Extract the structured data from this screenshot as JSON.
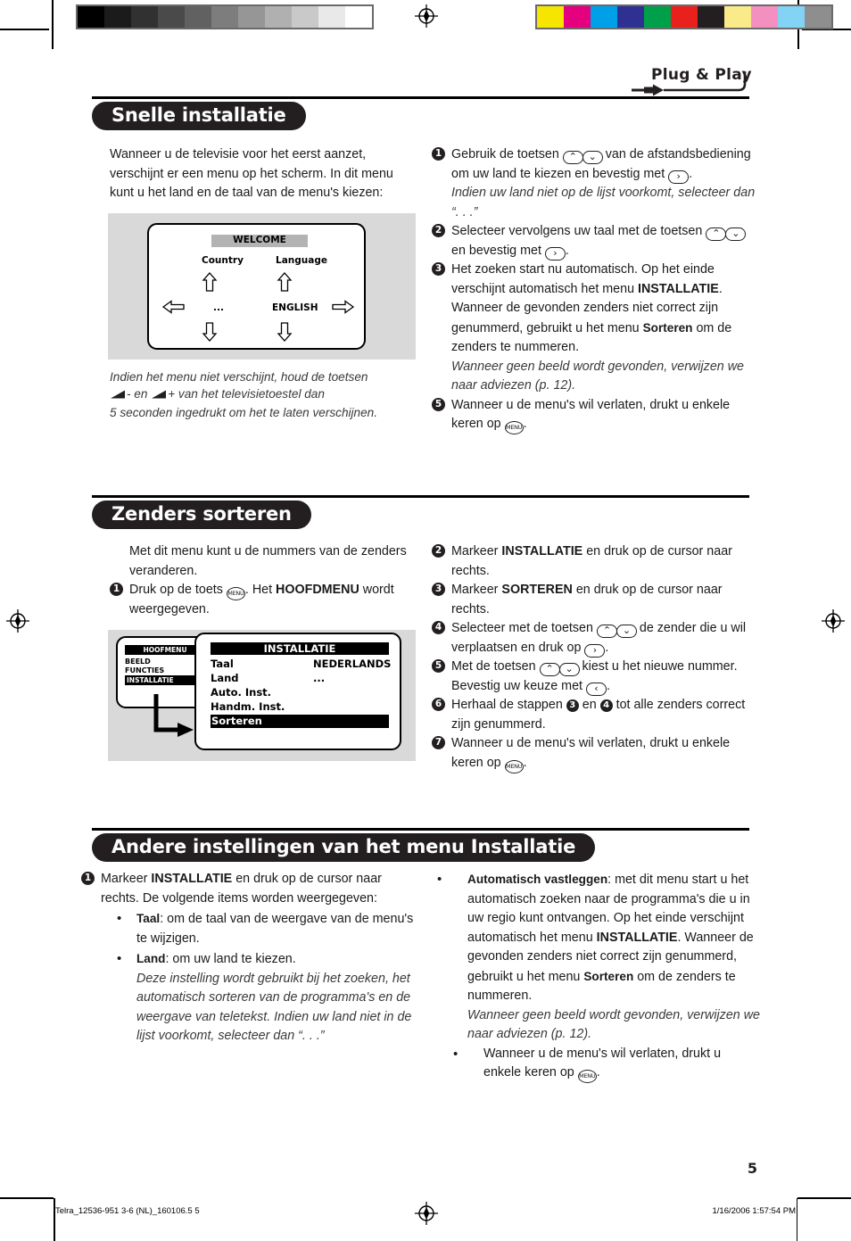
{
  "prepress": {
    "gray_swatches": [
      "#000000",
      "#1b1b1b",
      "#313131",
      "#4a4a4a",
      "#616161",
      "#7d7d7d",
      "#969696",
      "#b0b0b0",
      "#c9c9c9",
      "#e9e9e9",
      "#ffffff"
    ],
    "color_swatches": [
      "#f5e500",
      "#e4007f",
      "#00a0e9",
      "#2e3192",
      "#00a04a",
      "#e8211c",
      "#231f20",
      "#faeb8a",
      "#f490c0",
      "#83d3f5",
      "#8e8e8e"
    ],
    "registration_icon": "registration-target-icon"
  },
  "logo": {
    "text": "Plug & Play",
    "icon": "power-plug-icon"
  },
  "sections": [
    {
      "id": "snelle-installatie",
      "title": "Snelle installatie",
      "intro": "Wanneer u de televisie voor het eerst aanzet, verschijnt er een menu op het scherm. In dit menu kunt u het land en de taal van de menu's kiezen:",
      "figure_note_line1": "Indien het menu niet verschijnt, houd de toetsen",
      "figure_note_line2_a": "- en",
      "figure_note_line2_b": "+ van het televisietoestel dan",
      "figure_note_line3": "5 seconden ingedrukt om het te laten verschijnen.",
      "figure": {
        "name": "welcome-screen",
        "header": "WELCOME",
        "left_label": "Country",
        "left_value": "...",
        "right_label": "Language",
        "right_value": "ENGLISH"
      },
      "steps": [
        {
          "num": "❶",
          "parts": [
            {
              "t": "text",
              "v": "Gebruik de toetsen "
            },
            {
              "t": "keypair",
              "v": "⌃⌄"
            },
            {
              "t": "text",
              "v": " van de afstandsbediening om uw land te kiezen en bevestig met "
            },
            {
              "t": "key",
              "v": "›"
            },
            {
              "t": "text",
              "v": "."
            }
          ],
          "italic": "Indien uw land niet op de lijst voorkomt, selecteer dan “. . .”"
        },
        {
          "num": "❷",
          "parts": [
            {
              "t": "text",
              "v": "Selecteer vervolgens uw taal met de toetsen "
            },
            {
              "t": "keypair",
              "v": "⌃⌄"
            },
            {
              "t": "text",
              "v": " en bevestig met "
            },
            {
              "t": "key",
              "v": "›"
            },
            {
              "t": "text",
              "v": "."
            }
          ],
          "italic": ""
        },
        {
          "num": "❸",
          "parts": [
            {
              "t": "text",
              "v": "Het zoeken start nu automatisch. Op het einde verschijnt automatisch het menu "
            },
            {
              "t": "bold",
              "v": "INSTALLATIE"
            },
            {
              "t": "text",
              "v": ". Wanneer de gevonden zenders niet correct zijn genummerd, gebruikt u het menu "
            },
            {
              "t": "boldsm",
              "v": "Sorteren"
            },
            {
              "t": "text",
              "v": " om de zenders te nummeren."
            }
          ],
          "italic": "Wanneer geen beeld wordt gevonden, verwijzen we naar adviezen (p. 12)."
        },
        {
          "num": "❺",
          "parts": [
            {
              "t": "text",
              "v": "Wanneer u de menu's wil verlaten, drukt u enkele keren op "
            },
            {
              "t": "menukey",
              "v": "MENU"
            },
            {
              "t": "text",
              "v": "."
            }
          ],
          "italic": ""
        }
      ]
    },
    {
      "id": "zenders-sorteren",
      "title": "Zenders sorteren",
      "intro": "Met dit menu kunt u de nummers van de zenders veranderen.",
      "figure": {
        "name": "installatie-menu-screen",
        "left_header": "HOOFMENU",
        "left_items": [
          "BEELD",
          "FUNCTIES",
          "INSTALLATIE"
        ],
        "left_selected": "INSTALLATIE",
        "right_header": "INSTALLATIE",
        "rows": [
          {
            "label": "Taal",
            "value": "NEDERLANDS",
            "highlight": false
          },
          {
            "label": "Land",
            "value": "...",
            "highlight": false
          },
          {
            "label": "Auto. Inst.",
            "value": "",
            "highlight": false
          },
          {
            "label": "Handm. Inst.",
            "value": "",
            "highlight": false
          },
          {
            "label": "Sorteren",
            "value": "",
            "highlight": true
          }
        ]
      },
      "steps_left": [
        {
          "num": "❶",
          "parts": [
            {
              "t": "text",
              "v": "Druk op de toets "
            },
            {
              "t": "menukey",
              "v": "MENU"
            },
            {
              "t": "text",
              "v": ". Het "
            },
            {
              "t": "bold",
              "v": "HOOFDMENU"
            },
            {
              "t": "text",
              "v": " wordt weergegeven."
            }
          ]
        }
      ],
      "steps_right": [
        {
          "num": "❷",
          "parts": [
            {
              "t": "text",
              "v": "Markeer "
            },
            {
              "t": "bold",
              "v": "INSTALLATIE"
            },
            {
              "t": "text",
              "v": " en druk op de cursor naar rechts."
            }
          ]
        },
        {
          "num": "❸",
          "parts": [
            {
              "t": "text",
              "v": "Markeer "
            },
            {
              "t": "bold",
              "v": "SORTEREN"
            },
            {
              "t": "text",
              "v": " en druk op de cursor naar rechts."
            }
          ]
        },
        {
          "num": "❹",
          "parts": [
            {
              "t": "text",
              "v": "Selecteer met de toetsen "
            },
            {
              "t": "keypair",
              "v": "⌃⌄"
            },
            {
              "t": "text",
              "v": " de zender die u wil verplaatsen en druk op "
            },
            {
              "t": "key",
              "v": "›"
            },
            {
              "t": "text",
              "v": "."
            }
          ]
        },
        {
          "num": "❺",
          "parts": [
            {
              "t": "text",
              "v": "Met de toetsen "
            },
            {
              "t": "keypair",
              "v": "⌃⌄"
            },
            {
              "t": "text",
              "v": " kiest u het nieuwe nummer. Bevestig uw keuze met "
            },
            {
              "t": "key",
              "v": "‹"
            },
            {
              "t": "text",
              "v": "."
            }
          ]
        },
        {
          "num": "❻",
          "parts": [
            {
              "t": "text",
              "v": "Herhaal de stappen "
            },
            {
              "t": "inum",
              "v": "3"
            },
            {
              "t": "text",
              "v": " en "
            },
            {
              "t": "inum",
              "v": "4"
            },
            {
              "t": "text",
              "v": " tot alle zenders correct zijn genummerd."
            }
          ]
        },
        {
          "num": "❼",
          "parts": [
            {
              "t": "text",
              "v": "Wanneer u de menu's wil verlaten, drukt u enkele keren op "
            },
            {
              "t": "menukey",
              "v": "MENU"
            },
            {
              "t": "text",
              "v": "."
            }
          ]
        }
      ]
    },
    {
      "id": "andere-instellingen",
      "title": "Andere instellingen van het menu Installatie",
      "left": {
        "step_num": "❶",
        "step_text_parts": [
          {
            "t": "text",
            "v": "Markeer "
          },
          {
            "t": "bold",
            "v": "INSTALLATIE"
          },
          {
            "t": "text",
            "v": " en druk op de cursor naar rechts. De volgende items worden weergegeven:"
          }
        ],
        "bullets": [
          {
            "parts": [
              {
                "t": "boldsm",
                "v": "Taal"
              },
              {
                "t": "text",
                "v": ": om de taal van de weergave van de menu's te wijzigen."
              }
            ],
            "italic": ""
          },
          {
            "parts": [
              {
                "t": "boldsm",
                "v": "Land"
              },
              {
                "t": "text",
                "v": ": om uw land te kiezen."
              }
            ],
            "italic": "Deze instelling wordt gebruikt bij het zoeken, het automatisch sorteren van de programma's en de weergave van teletekst. Indien uw land niet in de lijst voorkomt, selecteer dan “. . .”"
          }
        ]
      },
      "right": {
        "bullets": [
          {
            "parts": [
              {
                "t": "boldsm",
                "v": "Automatisch vastleggen"
              },
              {
                "t": "text",
                "v": ": met dit menu start u het automatisch zoeken naar de programma's die u in uw regio kunt ontvangen. Op het einde verschijnt automatisch het menu "
              },
              {
                "t": "bold",
                "v": "INSTALLATIE"
              },
              {
                "t": "text",
                "v": ". Wanneer de gevonden zenders niet correct zijn genummerd, gebruikt u het menu "
              },
              {
                "t": "boldsm",
                "v": "Sorteren"
              },
              {
                "t": "text",
                "v": " om de zenders te nummeren."
              }
            ],
            "italic": "Wanneer geen beeld wordt gevonden, verwijzen we naar adviezen (p. 12)."
          },
          {
            "parts": [
              {
                "t": "text",
                "v": "Wanneer u de menu's wil verlaten, drukt u enkele keren op "
              },
              {
                "t": "menukey",
                "v": "MENU"
              },
              {
                "t": "text",
                "v": "."
              }
            ],
            "italic": ""
          }
        ]
      }
    }
  ],
  "page_number": "5",
  "footer": {
    "left": "Telra_12536-951 3-6 (NL)_160106.5   5",
    "right": "1/16/2006   1:57:54 PM"
  }
}
